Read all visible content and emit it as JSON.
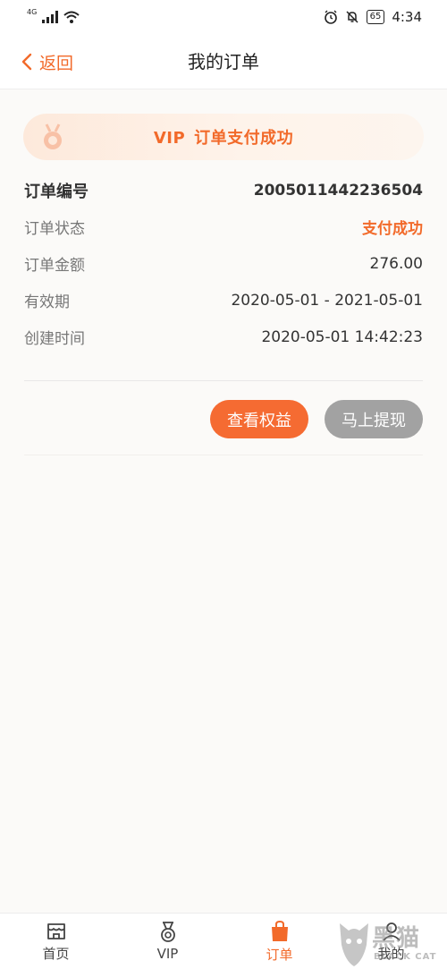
{
  "status_bar": {
    "network": "4G",
    "battery": "65",
    "time": "4:34"
  },
  "header": {
    "back_label": "返回",
    "title": "我的订单"
  },
  "banner": {
    "vip": "VIP",
    "text": "订单支付成功"
  },
  "order": {
    "rows": [
      {
        "label": "订单编号",
        "value": "2005011442236504"
      },
      {
        "label": "订单状态",
        "value": "支付成功"
      },
      {
        "label": "订单金额",
        "value": "276.00"
      },
      {
        "label": "有效期",
        "value": "2020-05-01 - 2021-05-01"
      },
      {
        "label": "创建时间",
        "value": "2020-05-01 14:42:23"
      }
    ]
  },
  "actions": {
    "view_benefits": "查看权益",
    "withdraw": "马上提现"
  },
  "tabbar": {
    "items": [
      {
        "label": "首页",
        "icon": "store-icon"
      },
      {
        "label": "VIP",
        "icon": "medal-icon"
      },
      {
        "label": "订单",
        "icon": "shopping-bag-icon"
      },
      {
        "label": "我的",
        "icon": "user-icon"
      }
    ],
    "active": "订单"
  },
  "watermark": {
    "text": "黑猫",
    "sub": "BLACK CAT"
  },
  "colors": {
    "accent": "#f26a2a",
    "button_secondary": "#a2a2a2"
  }
}
